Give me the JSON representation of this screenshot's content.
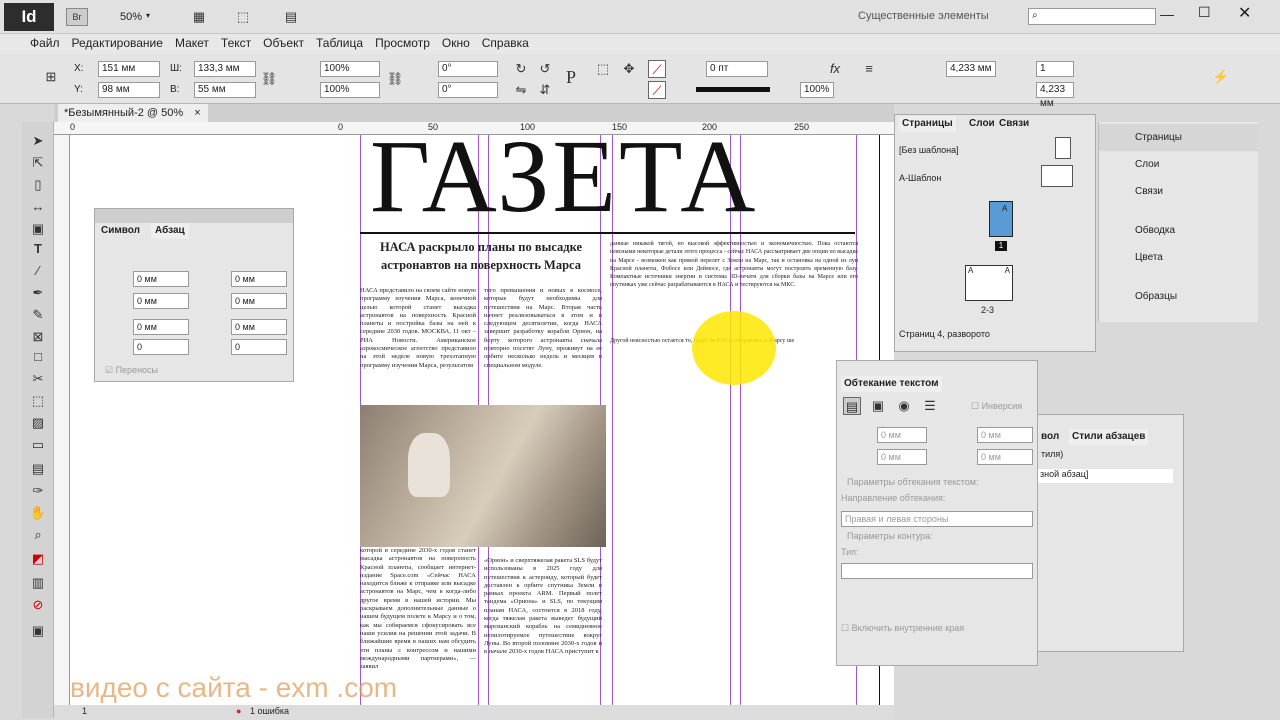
{
  "app": {
    "logo": "Id",
    "bridge": "Br",
    "zoom": "50%",
    "workspace": "Существенные элементы"
  },
  "menu": [
    "Файл",
    "Редактирование",
    "Макет",
    "Текст",
    "Объект",
    "Таблица",
    "Просмотр",
    "Окно",
    "Справка"
  ],
  "control": {
    "x_label": "X:",
    "x": "151 мм",
    "y_label": "Y:",
    "y": "98 мм",
    "w_label": "Ш:",
    "w": "133,3 мм",
    "h_label": "В:",
    "h": "55 мм",
    "scale_x": "100%",
    "scale_y": "100%",
    "angle": "0°",
    "shear": "0°",
    "stroke": "0 пт",
    "gutter": "4,233 мм",
    "cols": "1",
    "gutter2": "4,233 мм",
    "opacity": "100%",
    "p_glyph": "P"
  },
  "document": {
    "tab": "*Безымянный-2 @ 50%",
    "close": "×"
  },
  "ruler_marks": [
    "0",
    "50",
    "100",
    "150",
    "200",
    "250"
  ],
  "newspaper": {
    "masthead": "ГАЗЕТА",
    "headline": "НАСА раскрыло планы по высадке астронавтов на поверхность Марса",
    "col1a": "НАСА представило на своем сайте новую программу изучения Марса, конечной целью которой станет высадка астронавтов на поверхность Красной планеты и постройка базы на ней к середине 2030 годов. МОСКВА, 11 окт – РИА Новости. Американское аэрокосмическое агентство представило на этой неделе новую трехэтапную программу изучения Марса, результатом",
    "col2a": "того превышения и новых в космосе, которые будут необходимы для путешествия на Марс. Вторая часть начнет реализовываться в этом и в следующем десятилетии, когда НАСА завершит разработку корабля Орион, на борту которого астронавты сначала повторно посетят Луну, проживут на ее орбите несколько недель и месяцев в специальном модуле.",
    "col3a": "данные никакой тягой, но высокой эффективностью и экономичностью. Пока остаются неясными некоторые детали этого процесса - сейчас НАСА рассматривает две опции по высадке на Марсе - возможен как прямой перелет с Земли на Марс, так и остановка на одной из лун Красной планеты, Фобосе или Деймосе, где астронавты могут построить временную базу. Компактные источники энергии и системы 3D-печати для сборки базы на Марсе или его спутниках уже сейчас разрабатываются в НАСА и тестируются на МКС.",
    "col3b": "Другой неясностью остается то, будет ли НАСА отправлять к Марсу ше",
    "col1b": "которой в середине 2030-х годов станет высадка астронавтов на поверхность Красной планеты, сообщает интернет-издание Space.com «Сейчас НАСА находится ближе к отправке или высадке астронавтов на Марс, чем в когда-либо другое время в нашей истории. Мы раскрываем дополнительные данные о нашем будущем полете к Марсу и о том, как мы собираемся сфокусировать все наши усилия на решении этой задачи. В ближайшие время в наших нам обсудить эти планы с конгрессом и нашими международными партнерами», — заявил",
    "col2b": "«Орион» и сверхтяжелая ракета SLS будут использованы в 2025 году для путешествия к астероиду, который будет доставлен к орбите спутника Земли в рамках проекта ARM. Первый полет тандема «Ориона» и SLS, по текущим планам НАСА, состоится в 2018 году, когда тяжелая ракета выведет будущий марсианский корабль на семидневное непилотируемое путешествие вокруг Луны. Во второй половине 2030-х годов и в начале 2030-х годов НАСА приступит к"
  },
  "panel_symbol": {
    "tab1": "Символ",
    "tab2": "Абзац",
    "vals": [
      "0 мм",
      "0 мм",
      "0 мм",
      "0 мм",
      "0 мм",
      "0 мм",
      "0",
      "0"
    ],
    "hyphen": "Переносы"
  },
  "panel_pages": {
    "tab1": "Страницы",
    "tab2": "Слои",
    "tab3": "Связи",
    "none": "[Без шаблона]",
    "master": "А-Шаблон",
    "page1": "1",
    "spread": "2-3",
    "a1": "A",
    "a2": "A",
    "a3": "A",
    "footer": "Страниц 4, разворото"
  },
  "dock": [
    "Страницы",
    "Слои",
    "Связи",
    "Обводка",
    "Цвета",
    "Образцы"
  ],
  "panel_wrap": {
    "title": "Обтекание текстом",
    "invert": "Инверсия",
    "v1": "0 мм",
    "v2": "0 мм",
    "v3": "0 мм",
    "v4": "0 мм",
    "params": "Параметры обтекания текстом:",
    "dir_label": "Направление обтекания:",
    "dir_value": "Правая и левая стороны",
    "contour": "Параметры контура:",
    "type": "Тип:",
    "inner": "Включить внутренние края"
  },
  "panel_styles": {
    "tab1": "вол",
    "tab2": "Стили абзацев",
    "t1": "тиля)",
    "t2": "зной абзац]"
  },
  "status": {
    "page": "1",
    "errors": "1 ошибка"
  },
  "watermark": "видео с сайта - exm          .com"
}
